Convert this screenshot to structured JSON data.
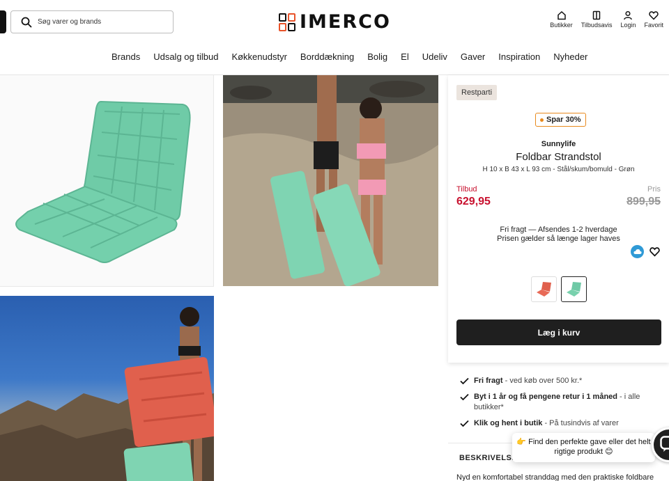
{
  "header": {
    "search_placeholder": "Søg varer og brands",
    "logo_text": "IMERCO",
    "icons": [
      {
        "label": "Butikker",
        "icon": "store-icon"
      },
      {
        "label": "Tilbudsavis",
        "icon": "catalog-icon"
      },
      {
        "label": "Login",
        "icon": "user-icon"
      },
      {
        "label": "Favorit",
        "icon": "heart-icon"
      }
    ]
  },
  "nav": [
    "Brands",
    "Udsalg og tilbud",
    "Køkkenudstyr",
    "Borddækning",
    "Bolig",
    "El",
    "Udeliv",
    "Gaver",
    "Inspiration",
    "Nyheder"
  ],
  "product": {
    "tag": "Restparti",
    "discount_badge": "Spar 30%",
    "brand": "Sunnylife",
    "name": "Foldbar Strandstol",
    "spec": "H 10 x B 43 x L 93 cm - Stål/skum/bomuld - Grøn",
    "offer_label": "Tilbud",
    "offer_price": "629,95",
    "price_label": "Pris",
    "old_price": "899,95",
    "shipping_line1": "Fri fragt — Afsendes 1-2 hverdage",
    "shipping_line2": "Prisen gælder så længe lager haves",
    "add_to_cart": "Læg i kurv",
    "swatch_colors": [
      "#e0604d",
      "#6fc9a6"
    ]
  },
  "usps": [
    {
      "bold": "Fri fragt",
      "rest": " - ved køb over 500 kr.*"
    },
    {
      "bold": "Byt i 1 år og få pengene retur i 1 måned",
      "rest": " - i alle butikker*"
    },
    {
      "bold": "Klik og hent i butik",
      "rest": " - På tusindvis af varer"
    }
  ],
  "description": {
    "heading": "BESKRIVELSE",
    "text": "Nyd en komfortabel stranddag med den praktiske foldbare"
  },
  "chat_bubble": "👉 Find den perfekte gave eller det helt rigtige produkt 😊",
  "colors": {
    "accent_red": "#c8102e",
    "badge_orange": "#e8891c",
    "button_dark": "#1f1f1f",
    "chair_green": "#6fc9a6",
    "chair_red": "#e0604d"
  }
}
